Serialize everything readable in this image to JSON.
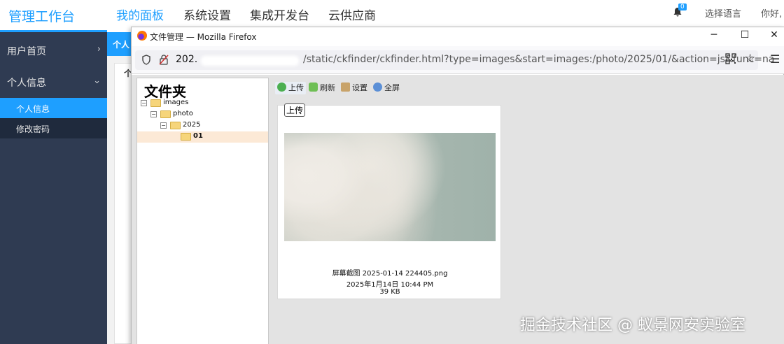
{
  "app": {
    "brand": "管理工作台",
    "nav": [
      "我的面板",
      "系统设置",
      "集成开发台",
      "云供应商"
    ],
    "notification_count": "0",
    "language_label": "选择语言",
    "greeting": "你好,"
  },
  "sidebar": {
    "items": [
      {
        "label": "用户首页",
        "chevron": "›"
      },
      {
        "label": "个人信息",
        "chevron": "⌄"
      }
    ],
    "sub_items": [
      {
        "label": "个人信息"
      },
      {
        "label": "修改密码"
      }
    ]
  },
  "main": {
    "tab_label": "个人",
    "card_label": "个"
  },
  "firefox": {
    "title": "文件管理 — Mozilla Firefox",
    "window_controls": {
      "minimize": "─",
      "maximize": "☐",
      "close": "✕"
    },
    "url_host": "202.",
    "url_path": "/static/ckfinder/ckfinder.html?type=images&start=images:/photo/2025/01/&action=js&func=na",
    "icons": {
      "shield": "shield-icon",
      "lock": "insecure-lock-icon",
      "qr": "qr-code-icon",
      "star": "bookmark-star-icon",
      "menu": "hamburger-menu-icon"
    }
  },
  "ckfinder": {
    "folders_title": "文件夹",
    "tree": [
      {
        "label": "images",
        "toggle": "−"
      },
      {
        "label": "photo",
        "toggle": "−"
      },
      {
        "label": "2025",
        "toggle": "−"
      },
      {
        "label": "01",
        "toggle": ""
      }
    ],
    "toolbar": {
      "upload": "上传",
      "refresh": "刷新",
      "settings": "设置",
      "fullscreen": "全屏"
    },
    "upload_button": "上传",
    "file": {
      "name": "屏幕截图 2025-01-14 224405.png",
      "date": "2025年1月14日 10:44 PM",
      "size": "39 KB"
    }
  },
  "watermark": "掘金技术社区 @ 蚁景网安实验室",
  "colors": {
    "accent": "#1e9fff",
    "sidebar_bg": "#2f3b52",
    "selected_folder": "#fce9d6"
  }
}
